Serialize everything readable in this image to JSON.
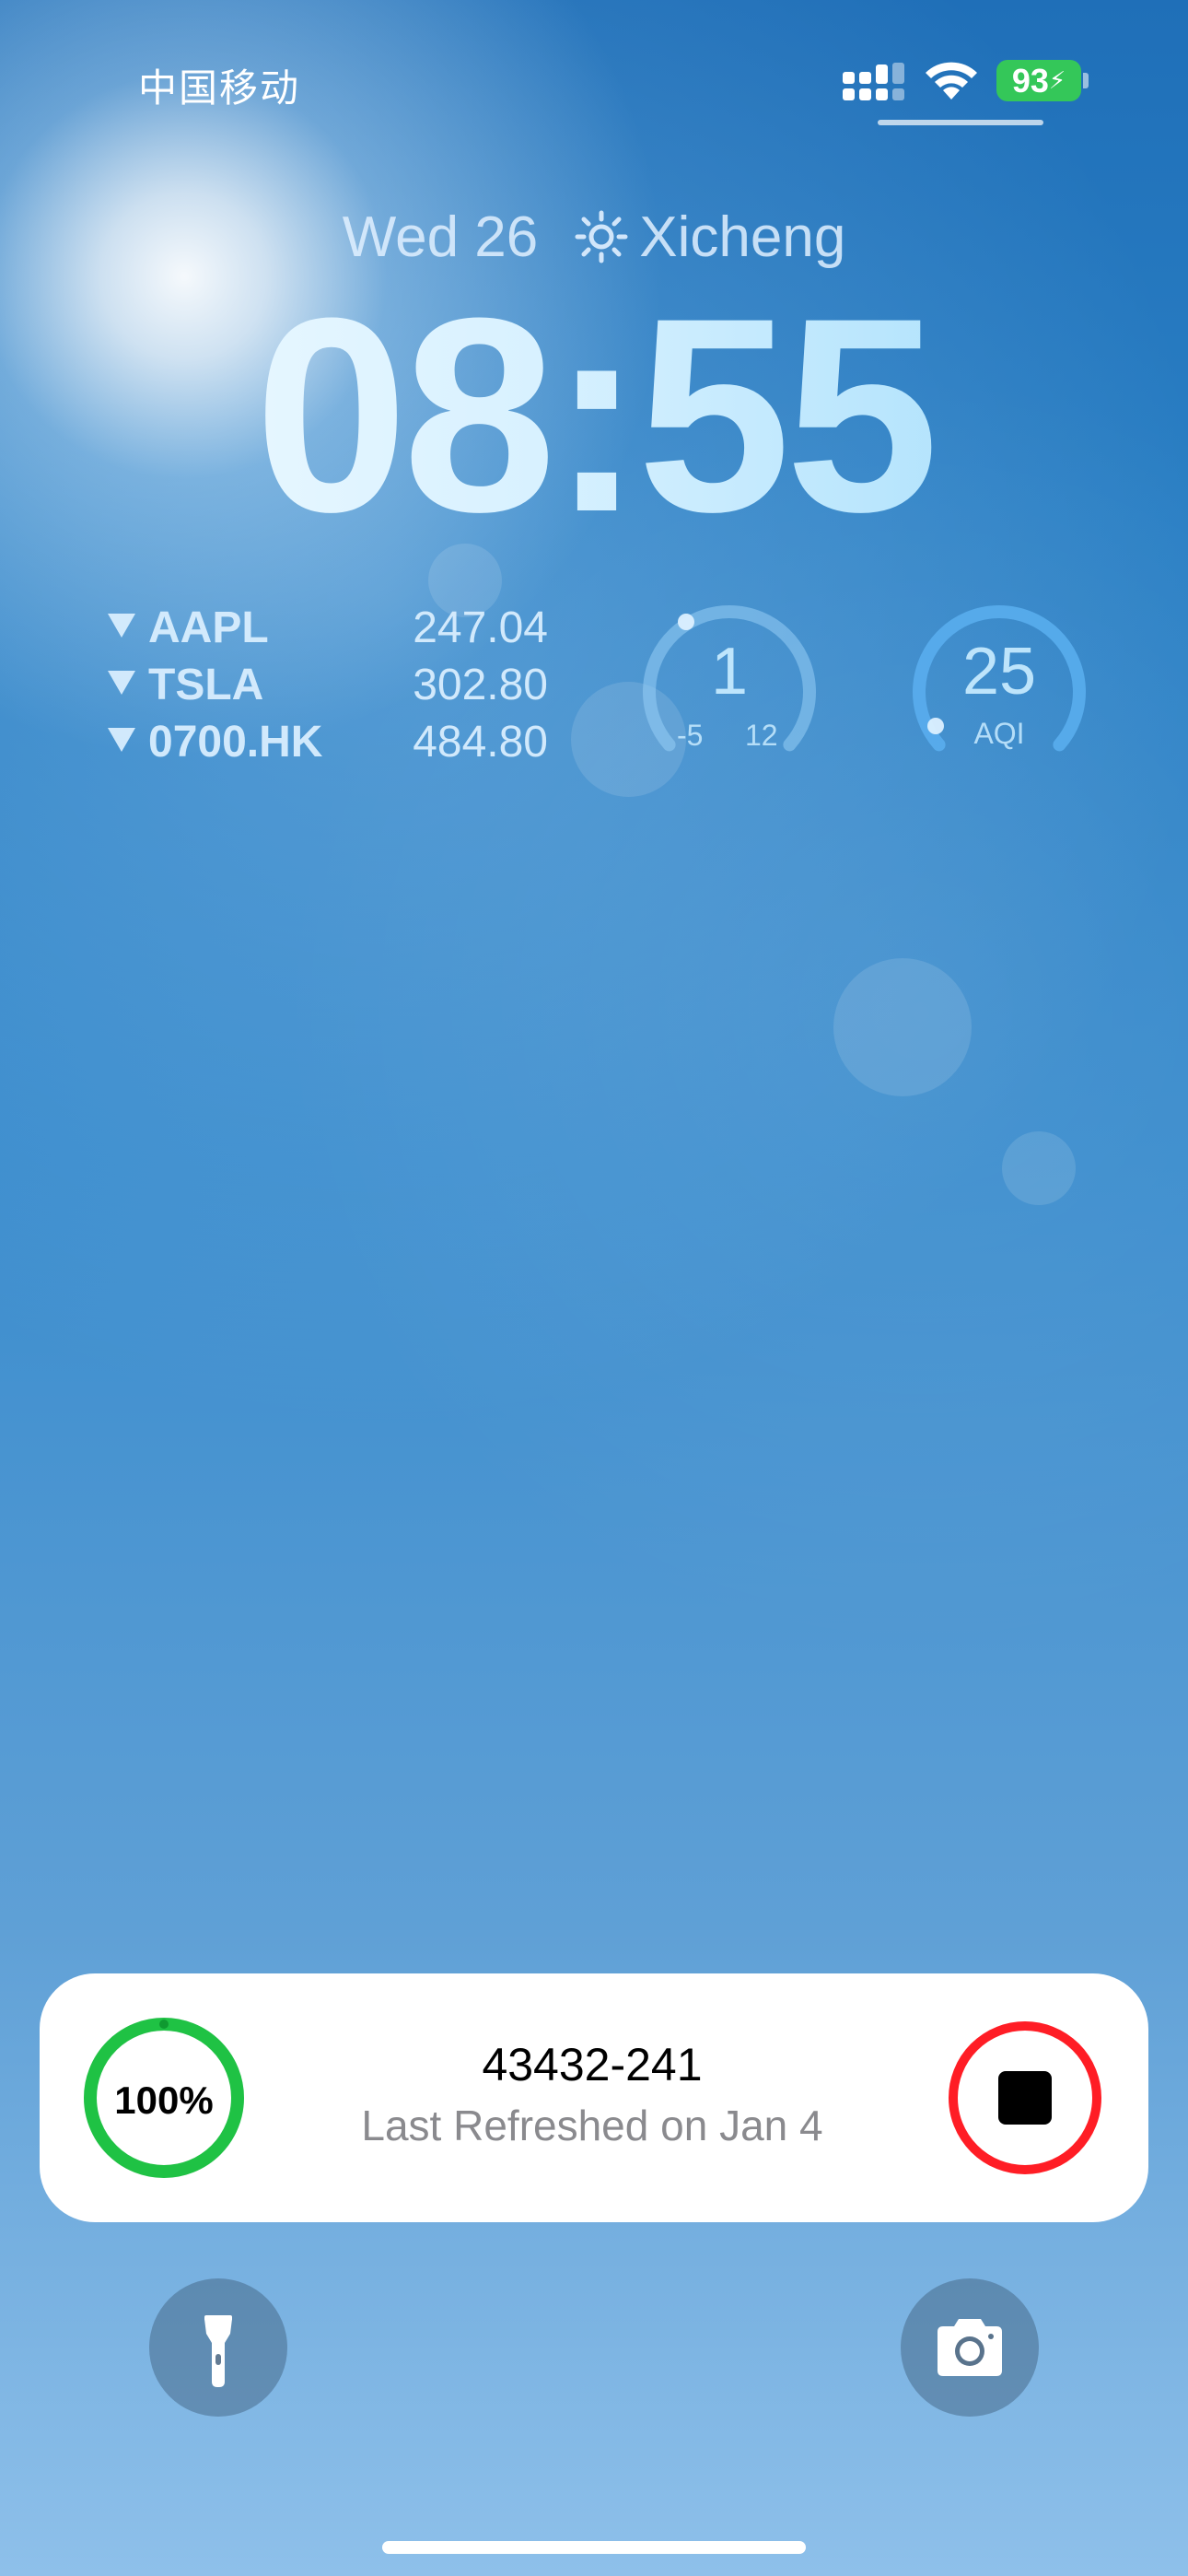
{
  "status_bar": {
    "carrier": "中国移动",
    "signal_icon": "cellular-signal-icon",
    "wifi_icon": "wifi-icon",
    "battery_percent": "93",
    "battery_color": "#34c759",
    "charging": true
  },
  "lock_screen": {
    "date": "Wed 26",
    "weather_icon": "sun-icon",
    "location": "Xicheng",
    "time": "08:55"
  },
  "stocks_widget": {
    "items": [
      {
        "symbol": "AAPL",
        "price": "247.04",
        "direction": "down"
      },
      {
        "symbol": "TSLA",
        "price": "302.80",
        "direction": "down"
      },
      {
        "symbol": "0700.HK",
        "price": "484.80",
        "direction": "down"
      }
    ]
  },
  "temperature_gauge": {
    "value": "1",
    "low": "-5",
    "high": "12"
  },
  "aqi_gauge": {
    "value": "25",
    "label": "AQI"
  },
  "live_activity": {
    "progress_label": "100%",
    "progress_value": 1.0,
    "title": "43432-241",
    "subtitle": "Last Refreshed on Jan 4",
    "progress_color": "#1fc244",
    "stop_color": "#ff1d25",
    "stop_icon": "stop-icon"
  },
  "quick_actions": {
    "left_icon": "flashlight-icon",
    "right_icon": "camera-icon"
  }
}
